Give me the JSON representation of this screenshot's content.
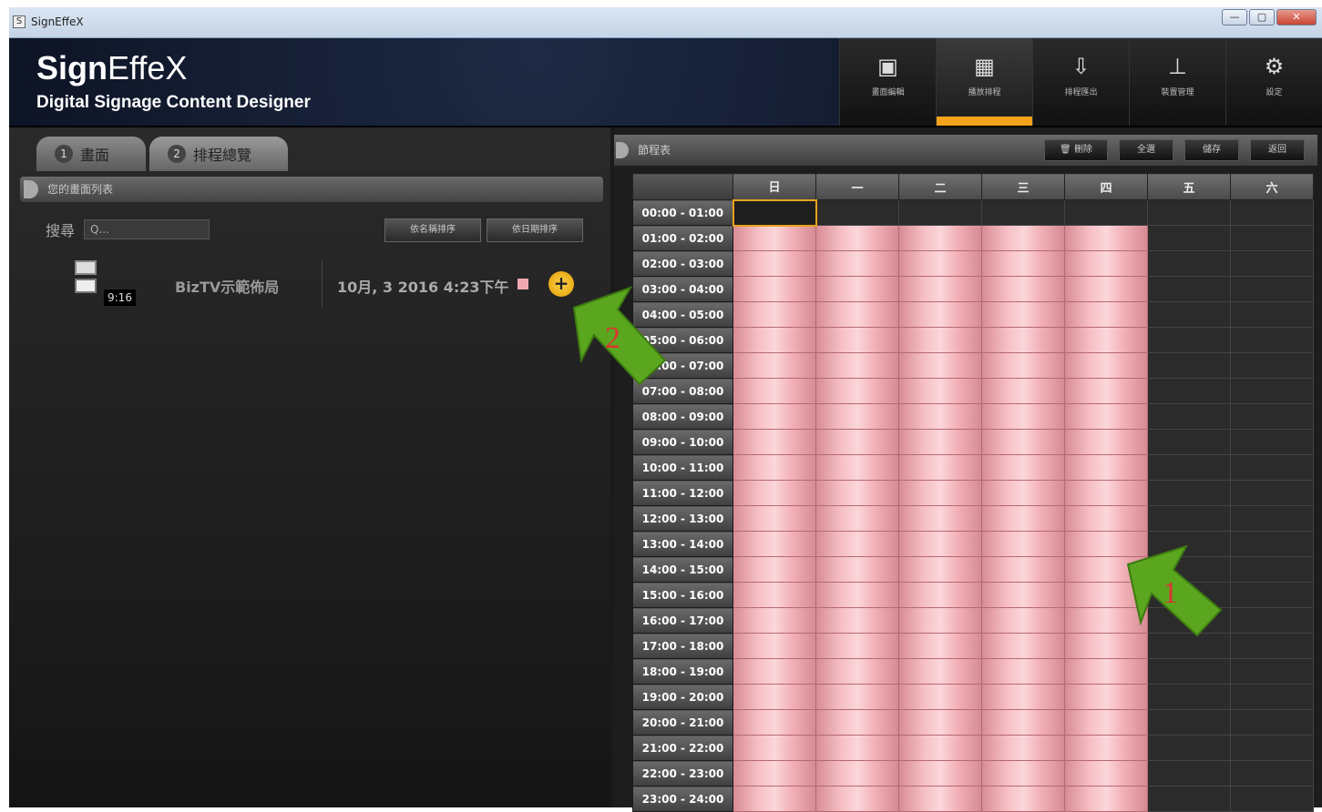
{
  "window": {
    "title": "SignEffeX",
    "controls": [
      "—",
      "▢",
      "✕"
    ]
  },
  "header": {
    "brand_bold": "Sign",
    "brand_light": "EffeX",
    "subtitle": "Digital Signage Content Designer",
    "nav": [
      {
        "icon": "screen-editor-icon",
        "label": "畫面編輯"
      },
      {
        "icon": "calendar-icon",
        "label": "播放排程",
        "active": true
      },
      {
        "icon": "export-icon",
        "label": "排程匯出"
      },
      {
        "icon": "device-icon",
        "label": "裝置管理"
      },
      {
        "icon": "gear-icon",
        "label": "設定"
      }
    ]
  },
  "left": {
    "tabs": [
      {
        "num": "1",
        "label": "畫面"
      },
      {
        "num": "2",
        "label": "排程總覽",
        "active": true
      }
    ],
    "section_title": "您的畫面列表",
    "search": {
      "label": "搜尋",
      "placeholder": "Q..."
    },
    "sort_buttons": [
      "依名稱排序",
      "依日期排序"
    ],
    "items": [
      {
        "name": "BizTV示範佈局",
        "duration": "9:16",
        "date": "10月, 3 2016 4:23下午",
        "swatch_color": "#f0a8b0"
      }
    ]
  },
  "right": {
    "title": "節程表",
    "buttons": [
      "刪除",
      "全選",
      "儲存",
      "返回"
    ],
    "days": [
      "日",
      "一",
      "二",
      "三",
      "四",
      "五",
      "六"
    ],
    "times": [
      "00:00 - 01:00",
      "01:00 - 02:00",
      "02:00 - 03:00",
      "03:00 - 04:00",
      "04:00 - 05:00",
      "05:00 - 06:00",
      "06:00 - 07:00",
      "07:00 - 08:00",
      "08:00 - 09:00",
      "09:00 - 10:00",
      "10:00 - 11:00",
      "11:00 - 12:00",
      "12:00 - 13:00",
      "13:00 - 14:00",
      "14:00 - 15:00",
      "15:00 - 16:00",
      "16:00 - 17:00",
      "17:00 - 18:00",
      "18:00 - 19:00",
      "19:00 - 20:00",
      "20:00 - 21:00",
      "21:00 - 22:00",
      "22:00 - 23:00",
      "23:00 - 24:00"
    ],
    "scheduled_days": [
      0,
      1,
      2,
      3,
      4
    ],
    "scheduled_from_hour": 1,
    "selected_cell": {
      "day": 0,
      "hour": 0
    },
    "scheduled_color": "#f6c0c6",
    "selected_color": "#e6a21a"
  },
  "annotations": {
    "arrow1_label": "1",
    "arrow2_label": "2",
    "arrow_color": "#5aa61e"
  }
}
